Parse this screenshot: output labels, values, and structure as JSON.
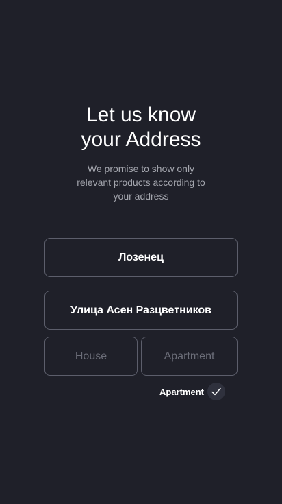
{
  "header": {
    "title_line1": "Let us know",
    "title_line2": "your Address",
    "subtitle_line1": "We promise to show only",
    "subtitle_line2": "relevant products according to",
    "subtitle_line3": "your address"
  },
  "form": {
    "district_value": "Лозенец",
    "street_value": "Улица Асен Разцветников",
    "house_placeholder": "House",
    "house_value": "",
    "apartment_placeholder": "Apartment",
    "apartment_value": ""
  },
  "apartment_toggle": {
    "label": "Apartment",
    "checked": true,
    "icon": "check-icon"
  },
  "colors": {
    "background": "#1f2029",
    "field_border": "#5c5e6b",
    "text_primary": "#ffffff",
    "text_secondary": "#a3a5ad",
    "check_bg": "#2f313d"
  }
}
